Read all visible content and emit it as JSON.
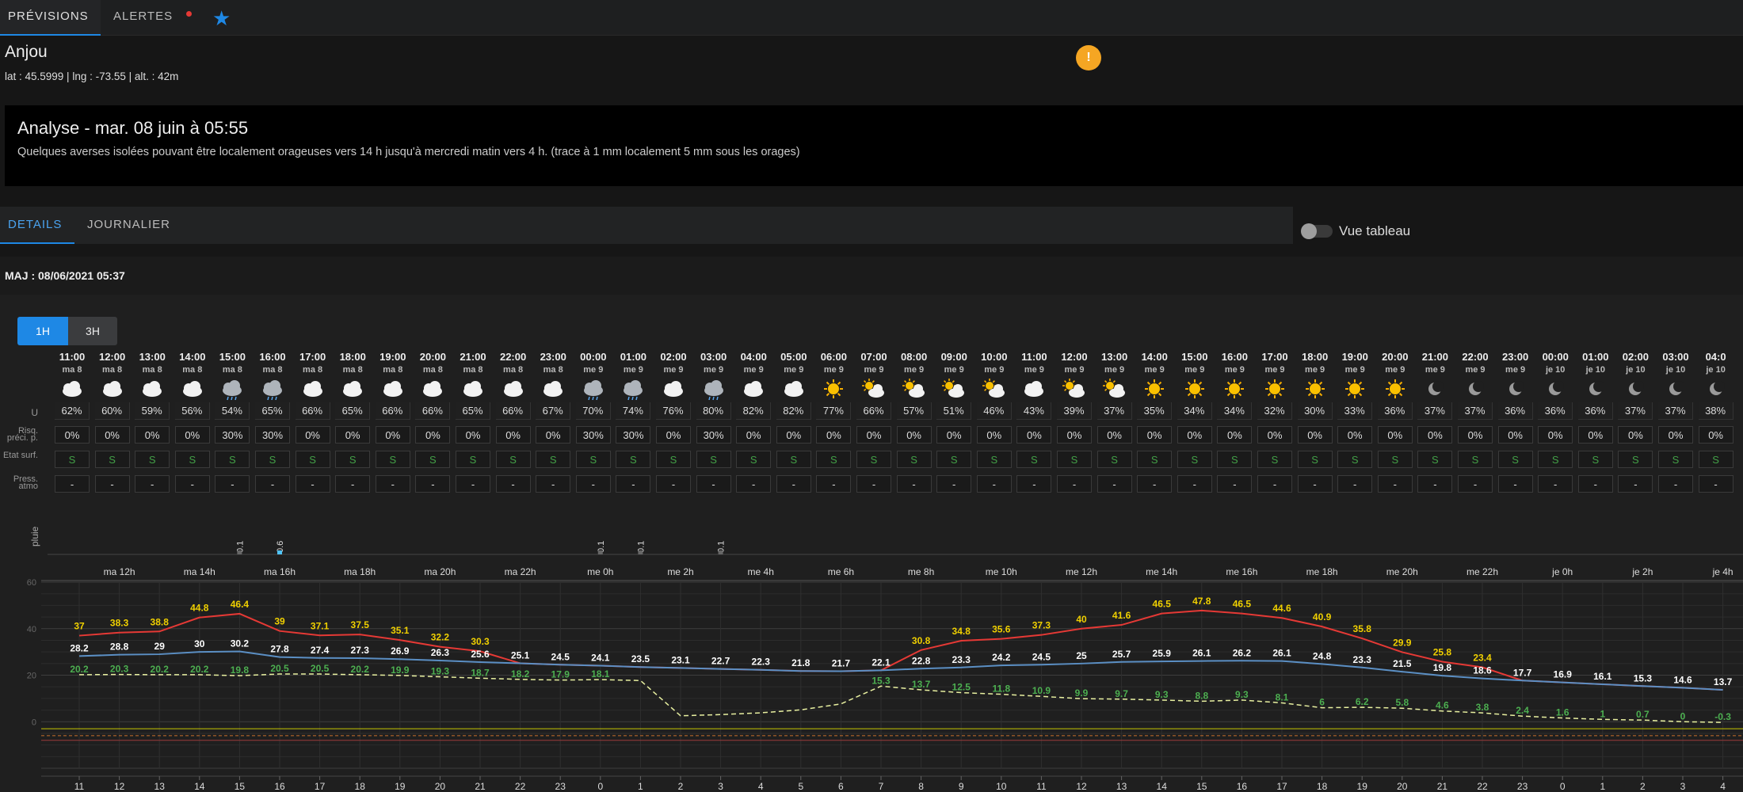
{
  "topbar": {
    "tab_previsions": "PRÉVISIONS",
    "tab_alertes": "ALERTES"
  },
  "location": {
    "name": "Anjou",
    "coords": "lat : 45.5999 | lng : -73.55 | alt. : 42m"
  },
  "analysis": {
    "title": "Analyse - mar. 08 juin à 05:55",
    "text": "Quelques averses isolées pouvant être localement orageuses vers 14 h jusqu'à mercredi matin vers 4 h. (trace à 1 mm localement 5 mm sous les orages)"
  },
  "subtabs": {
    "details": "DETAILS",
    "journalier": "JOURNALIER"
  },
  "toggle": {
    "label": "Vue tableau"
  },
  "maj": "MAJ : 08/06/2021 05:37",
  "buttons": {
    "b1h": "1H",
    "b3h": "3H"
  },
  "row_labels": {
    "u": "U",
    "risq": "Risq. préci. p.",
    "etat": "Etat surf.",
    "press": "Press. atmo",
    "pluie": "pluie"
  },
  "warning_icon": "warning-triangle-icon",
  "colors": {
    "accent": "#1e88e5",
    "warning": "#f5a623",
    "hot": "#f0d000",
    "temp": "#ffffff",
    "dew": "#4caf50",
    "red": "#e53935",
    "blue": "#5b8fc4"
  },
  "forecast": {
    "times": [
      "11:00",
      "12:00",
      "13:00",
      "14:00",
      "15:00",
      "16:00",
      "17:00",
      "18:00",
      "19:00",
      "20:00",
      "21:00",
      "22:00",
      "23:00",
      "00:00",
      "01:00",
      "02:00",
      "03:00",
      "04:00",
      "05:00",
      "06:00",
      "07:00",
      "08:00",
      "09:00",
      "10:00",
      "11:00",
      "12:00",
      "13:00",
      "14:00",
      "15:00",
      "16:00",
      "17:00",
      "18:00",
      "19:00",
      "20:00",
      "21:00",
      "22:00",
      "23:00",
      "00:00",
      "01:00",
      "02:00",
      "03:00",
      "04:0"
    ],
    "days": [
      "ma 8",
      "ma 8",
      "ma 8",
      "ma 8",
      "ma 8",
      "ma 8",
      "ma 8",
      "ma 8",
      "ma 8",
      "ma 8",
      "ma 8",
      "ma 8",
      "ma 8",
      "me 9",
      "me 9",
      "me 9",
      "me 9",
      "me 9",
      "me 9",
      "me 9",
      "me 9",
      "me 9",
      "me 9",
      "me 9",
      "me 9",
      "me 9",
      "me 9",
      "me 9",
      "me 9",
      "me 9",
      "me 9",
      "me 9",
      "me 9",
      "me 9",
      "me 9",
      "me 9",
      "me 9",
      "je 10",
      "je 10",
      "je 10",
      "je 10",
      "je 10"
    ],
    "icons": [
      "cloud",
      "cloud",
      "cloud",
      "cloud",
      "cloud-rain",
      "cloud-rain",
      "cloud",
      "cloud",
      "cloud",
      "cloud",
      "cloud",
      "cloud",
      "cloud",
      "cloud-rain",
      "cloud-rain",
      "cloud",
      "cloud-rain",
      "cloud",
      "cloud",
      "sun",
      "sun-cloud",
      "sun-cloud",
      "sun-cloud",
      "sun-cloud",
      "cloud",
      "sun-cloud",
      "sun-cloud",
      "sun",
      "sun",
      "sun",
      "sun",
      "sun",
      "sun",
      "sun",
      "moon",
      "moon",
      "moon",
      "moon",
      "moon",
      "moon",
      "moon",
      "moon"
    ],
    "humidity": [
      "62%",
      "60%",
      "59%",
      "56%",
      "54%",
      "65%",
      "66%",
      "65%",
      "66%",
      "66%",
      "65%",
      "66%",
      "67%",
      "70%",
      "74%",
      "76%",
      "80%",
      "82%",
      "82%",
      "77%",
      "66%",
      "57%",
      "51%",
      "46%",
      "43%",
      "39%",
      "37%",
      "35%",
      "34%",
      "34%",
      "32%",
      "30%",
      "33%",
      "36%",
      "37%",
      "37%",
      "36%",
      "36%",
      "36%",
      "37%",
      "37%",
      "38%"
    ],
    "risk": [
      "0%",
      "0%",
      "0%",
      "0%",
      "30%",
      "30%",
      "0%",
      "0%",
      "0%",
      "0%",
      "0%",
      "0%",
      "0%",
      "30%",
      "30%",
      "0%",
      "30%",
      "0%",
      "0%",
      "0%",
      "0%",
      "0%",
      "0%",
      "0%",
      "0%",
      "0%",
      "0%",
      "0%",
      "0%",
      "0%",
      "0%",
      "0%",
      "0%",
      "0%",
      "0%",
      "0%",
      "0%",
      "0%",
      "0%",
      "0%",
      "0%",
      "0%"
    ],
    "etat": "S",
    "press": "-"
  },
  "rain_marks": [
    {
      "hour": "15",
      "value": "0.1"
    },
    {
      "hour": "16",
      "value": "0.6"
    },
    {
      "hour": "0",
      "value": "0.1"
    },
    {
      "hour": "1",
      "value": "0.1"
    },
    {
      "hour": "3",
      "value": "0.1"
    }
  ],
  "chart_data": {
    "type": "line",
    "time_labels": [
      "ma 12h",
      "ma 14h",
      "ma 16h",
      "ma 18h",
      "ma 20h",
      "ma 22h",
      "me 0h",
      "me 2h",
      "me 4h",
      "me 6h",
      "me 8h",
      "me 10h",
      "me 12h",
      "me 14h",
      "me 16h",
      "me 18h",
      "me 20h",
      "me 22h",
      "je 0h",
      "je 2h",
      "je 4h"
    ],
    "hours": [
      "11",
      "12",
      "13",
      "14",
      "15",
      "16",
      "17",
      "18",
      "19",
      "20",
      "21",
      "22",
      "23",
      "0",
      "1",
      "2",
      "3",
      "4",
      "5",
      "6",
      "7",
      "8",
      "9",
      "10",
      "11",
      "12",
      "13",
      "14",
      "15",
      "16",
      "17",
      "18",
      "19",
      "20",
      "21",
      "22",
      "23",
      "0",
      "1",
      "2",
      "3",
      "4"
    ],
    "ylim": [
      -20,
      60
    ],
    "yticks": [
      0,
      20,
      40,
      60
    ],
    "series": [
      {
        "values": [
          37,
          38.3,
          38.8,
          44.8,
          46.4,
          39,
          37.1,
          37.5,
          35.1,
          32.2,
          30.3,
          null,
          null,
          null,
          null,
          null,
          null,
          null,
          null,
          null,
          null,
          30.8,
          34.8,
          35.6,
          37.3,
          40,
          41.6,
          46.5,
          47.8,
          46.5,
          44.6,
          40.9,
          35.8,
          29.9,
          25.8,
          23.4,
          null,
          null,
          null,
          null,
          null,
          null
        ]
      },
      {
        "values": [
          28.2,
          28.8,
          29,
          30,
          30.2,
          27.8,
          27.4,
          27.3,
          26.9,
          26.3,
          25.6,
          25.1,
          24.5,
          24.1,
          23.5,
          23.1,
          22.7,
          22.3,
          21.8,
          21.7,
          22.1,
          22.8,
          23.3,
          24.2,
          24.5,
          25,
          25.7,
          25.9,
          26.1,
          26.2,
          26.1,
          24.8,
          23.3,
          21.5,
          19.8,
          18.6,
          17.7,
          16.9,
          16.1,
          15.3,
          14.6,
          13.7
        ]
      },
      {
        "values": [
          20.2,
          20.3,
          20.2,
          20.2,
          19.8,
          20.5,
          20.5,
          20.2,
          19.9,
          19.3,
          18.7,
          18.2,
          17.9,
          18.1,
          null,
          null,
          null,
          null,
          null,
          null,
          15.3,
          13.7,
          12.5,
          11.8,
          10.9,
          9.9,
          9.7,
          9.3,
          8.8,
          9.3,
          8.1,
          6,
          6.2,
          5.8,
          4.6,
          3.8,
          2.4,
          1.6,
          1,
          0.7,
          0,
          -0.3
        ]
      }
    ]
  }
}
